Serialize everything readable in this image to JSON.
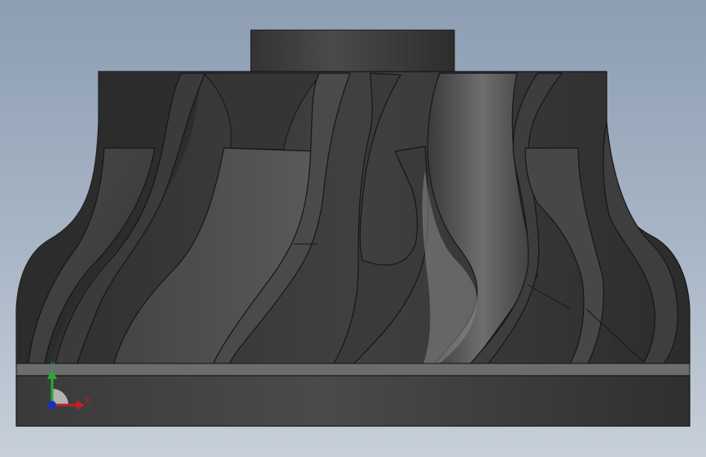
{
  "viewport": {
    "kind": "3D CAD model viewport",
    "model": "impeller",
    "background_top": "#8d9eb3",
    "background_bottom": "#c7d0da"
  },
  "model": {
    "body_color": "#3c3c3c",
    "edge_color": "#161616",
    "highlight_color": "#8a8a8a",
    "blade_count_visible": 10
  },
  "triad": {
    "x_label": "X",
    "y_label": "Y",
    "x_color": "#c0202a",
    "y_color": "#2aa838",
    "z_color": "#1a2ec8"
  }
}
